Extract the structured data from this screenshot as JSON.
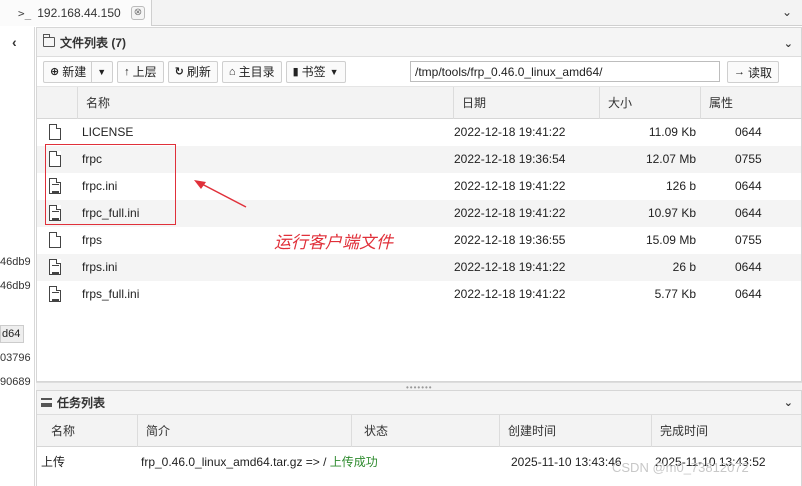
{
  "tab": {
    "prompt": ">_",
    "title": "192.168.44.150",
    "close": "⊗"
  },
  "left_panel": {
    "collapse": "‹",
    "fragments": [
      "46db9",
      "46db9",
      "d64",
      "03796",
      "90689"
    ]
  },
  "file_panel": {
    "title": "文件列表 (7)",
    "toolbar": {
      "new_label": "新建",
      "up_label": "上层",
      "refresh_label": "刷新",
      "home_label": "主目录",
      "bookmark_label": "书签",
      "path_value": "/tmp/tools/frp_0.46.0_linux_amd64/",
      "read_label": "读取"
    },
    "columns": {
      "name": "名称",
      "date": "日期",
      "size": "大小",
      "perm": "属性"
    },
    "files": [
      {
        "name": "LICENSE",
        "date": "2022-12-18 19:41:22",
        "size": "11.09 Kb",
        "perm": "0644",
        "icon": "file-icon"
      },
      {
        "name": "frpc",
        "date": "2022-12-18 19:36:54",
        "size": "12.07 Mb",
        "perm": "0755",
        "icon": "file-icon"
      },
      {
        "name": "frpc.ini",
        "date": "2022-12-18 19:41:22",
        "size": "126 b",
        "perm": "0644",
        "icon": "text-file-icon"
      },
      {
        "name": "frpc_full.ini",
        "date": "2022-12-18 19:41:22",
        "size": "10.97 Kb",
        "perm": "0644",
        "icon": "text-file-icon"
      },
      {
        "name": "frps",
        "date": "2022-12-18 19:36:55",
        "size": "15.09 Mb",
        "perm": "0755",
        "icon": "file-icon"
      },
      {
        "name": "frps.ini",
        "date": "2022-12-18 19:41:22",
        "size": "26 b",
        "perm": "0644",
        "icon": "text-file-icon"
      },
      {
        "name": "frps_full.ini",
        "date": "2022-12-18 19:41:22",
        "size": "5.77 Kb",
        "perm": "0644",
        "icon": "text-file-icon"
      }
    ],
    "annotation": "运行客户端文件",
    "annotation_color": "#e0303a"
  },
  "task_panel": {
    "title": "任务列表",
    "columns": {
      "name": "名称",
      "desc": "简介",
      "status": "状态",
      "created": "创建时间",
      "finished": "完成时间"
    },
    "tasks": [
      {
        "name": "上传",
        "desc": "frp_0.46.0_linux_amd64.tar.gz => / ",
        "desc_ok": "上传成功",
        "status": "",
        "created": "2025-11-10 13:43:46",
        "finished": "2025-11-10 13:43:52"
      }
    ]
  },
  "watermark": "CSDN @m0_73812072"
}
